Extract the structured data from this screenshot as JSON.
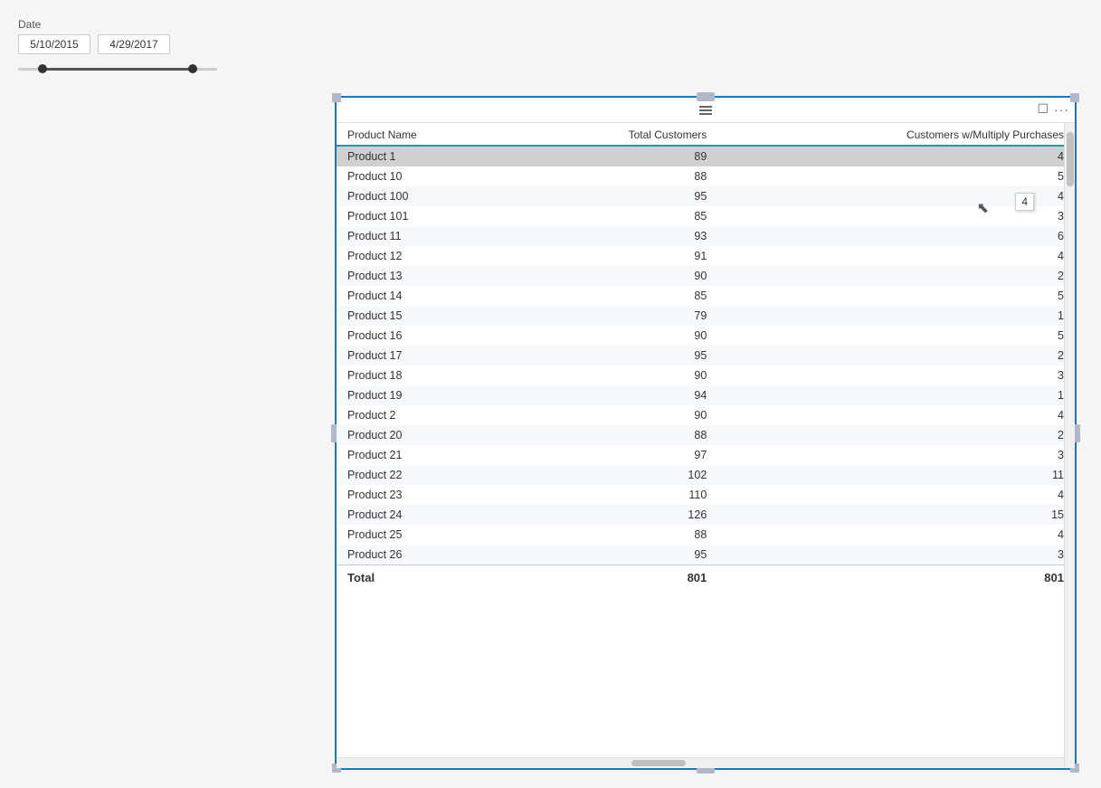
{
  "date_filter": {
    "label": "Date",
    "start_date": "5/10/2015",
    "end_date": "4/29/2017"
  },
  "panel": {
    "header_icon": "≡",
    "expand_icon": "⊡",
    "ellipsis_icon": "···"
  },
  "table": {
    "columns": [
      {
        "id": "product_name",
        "label": "Product Name"
      },
      {
        "id": "total_customers",
        "label": "Total Customers"
      },
      {
        "id": "customers_multiply",
        "label": "Customers w/Multiply Purchases"
      }
    ],
    "rows": [
      {
        "product": "Product 1",
        "total": 89,
        "multiply": 4,
        "selected": true
      },
      {
        "product": "Product 10",
        "total": 88,
        "multiply": 5,
        "selected": false
      },
      {
        "product": "Product 100",
        "total": 95,
        "multiply": 4,
        "selected": false
      },
      {
        "product": "Product 101",
        "total": 85,
        "multiply": 3,
        "selected": false
      },
      {
        "product": "Product 11",
        "total": 93,
        "multiply": 6,
        "selected": false
      },
      {
        "product": "Product 12",
        "total": 91,
        "multiply": 4,
        "selected": false
      },
      {
        "product": "Product 13",
        "total": 90,
        "multiply": 2,
        "selected": false
      },
      {
        "product": "Product 14",
        "total": 85,
        "multiply": 5,
        "selected": false
      },
      {
        "product": "Product 15",
        "total": 79,
        "multiply": 1,
        "selected": false
      },
      {
        "product": "Product 16",
        "total": 90,
        "multiply": 5,
        "selected": false
      },
      {
        "product": "Product 17",
        "total": 95,
        "multiply": 2,
        "selected": false
      },
      {
        "product": "Product 18",
        "total": 90,
        "multiply": 3,
        "selected": false
      },
      {
        "product": "Product 19",
        "total": 94,
        "multiply": 1,
        "selected": false
      },
      {
        "product": "Product 2",
        "total": 90,
        "multiply": 4,
        "selected": false
      },
      {
        "product": "Product 20",
        "total": 88,
        "multiply": 2,
        "selected": false
      },
      {
        "product": "Product 21",
        "total": 97,
        "multiply": 3,
        "selected": false
      },
      {
        "product": "Product 22",
        "total": 102,
        "multiply": 11,
        "selected": false
      },
      {
        "product": "Product 23",
        "total": 110,
        "multiply": 4,
        "selected": false
      },
      {
        "product": "Product 24",
        "total": 126,
        "multiply": 15,
        "selected": false
      },
      {
        "product": "Product 25",
        "total": 88,
        "multiply": 4,
        "selected": false
      },
      {
        "product": "Product 26",
        "total": 95,
        "multiply": 3,
        "selected": false
      }
    ],
    "footer": {
      "label": "Total",
      "total_customers": 801,
      "customers_multiply": 801
    },
    "tooltip_value": "4"
  }
}
